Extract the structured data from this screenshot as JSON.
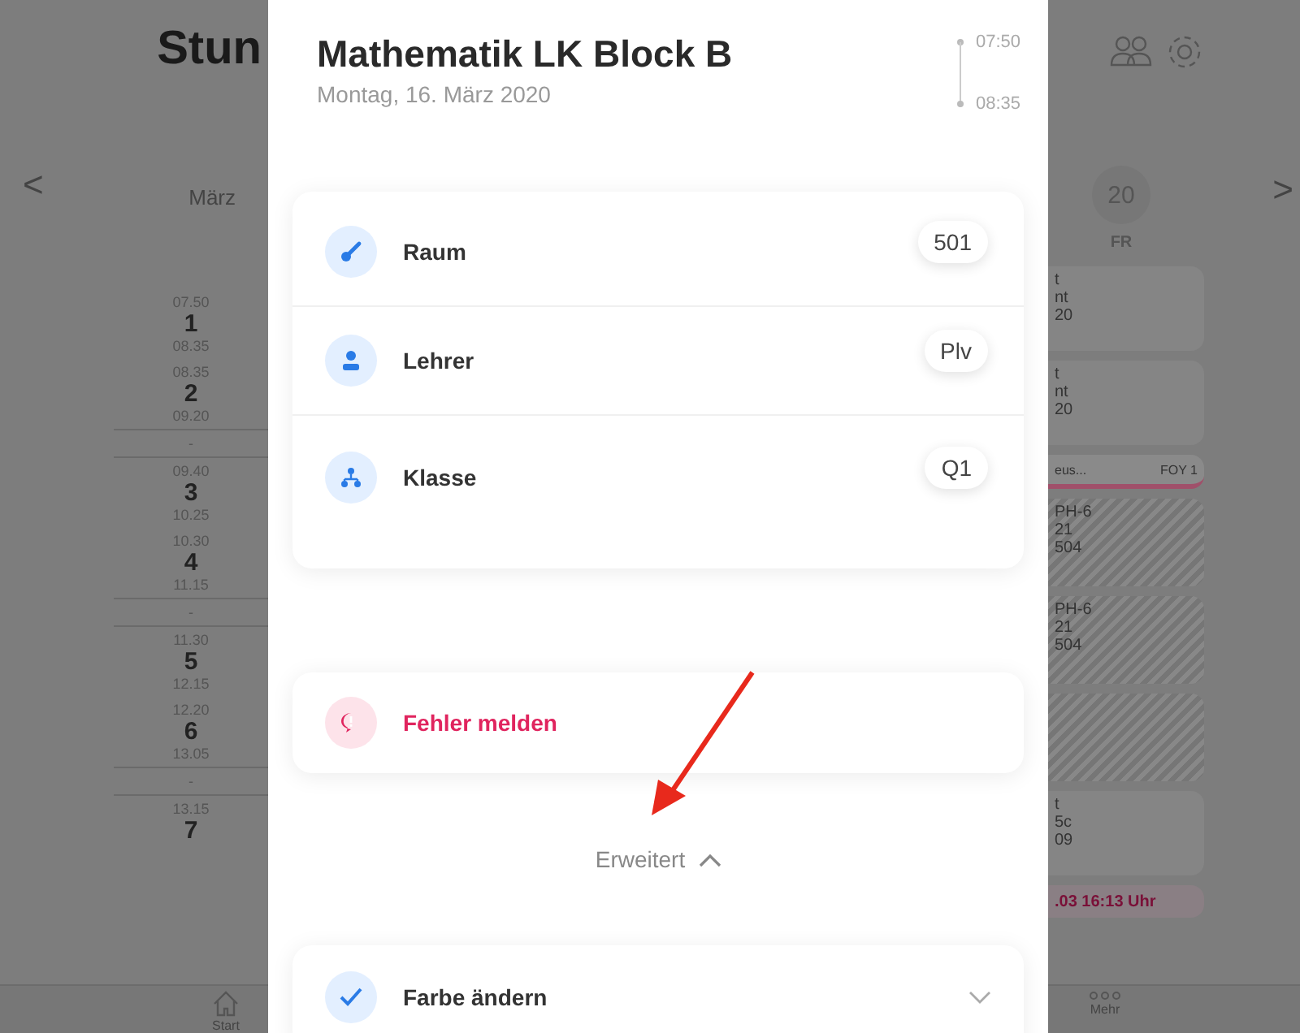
{
  "background": {
    "title": "Stun",
    "month": "März",
    "prev": "<",
    "next": ">",
    "day": {
      "number": "20",
      "weekday": "FR"
    },
    "periods": [
      {
        "kind": "lesson",
        "start": "07.50",
        "number": "1",
        "end": "08.35"
      },
      {
        "kind": "lesson",
        "start": "08.35",
        "number": "2",
        "end": "09.20"
      },
      {
        "kind": "break",
        "label": "-"
      },
      {
        "kind": "lesson",
        "start": "09.40",
        "number": "3",
        "end": "10.25"
      },
      {
        "kind": "lesson",
        "start": "10.30",
        "number": "4",
        "end": "11.15"
      },
      {
        "kind": "break",
        "label": "-"
      },
      {
        "kind": "lesson",
        "start": "11.30",
        "number": "5",
        "end": "12.15"
      },
      {
        "kind": "lesson",
        "start": "12.20",
        "number": "6",
        "end": "13.05"
      },
      {
        "kind": "break",
        "label": "-"
      },
      {
        "kind": "lesson",
        "start": "13.15",
        "number": "7"
      }
    ],
    "cards": [
      {
        "kind": "card",
        "lines": [
          "t",
          "nt",
          "20"
        ]
      },
      {
        "kind": "card",
        "lines": [
          "t",
          "nt",
          "20"
        ]
      },
      {
        "kind": "alert",
        "lines": [
          "eus...",
          "FOY 1"
        ]
      },
      {
        "kind": "hatched",
        "lines": [
          "PH-6",
          "21",
          "504"
        ]
      },
      {
        "kind": "hatched",
        "lines": [
          "PH-6",
          "21",
          "504"
        ]
      },
      {
        "kind": "hatched"
      },
      {
        "kind": "card",
        "lines": [
          "t",
          "5c",
          "09"
        ]
      },
      {
        "kind": "notice",
        "lines": [
          ".03 16:13 Uhr"
        ]
      }
    ],
    "nav": [
      {
        "kind": "home",
        "label": "Start"
      },
      {
        "kind": "more",
        "label": "Mehr"
      }
    ]
  },
  "sheet": {
    "title": "Mathematik LK Block B",
    "date": "Montag, 16. März 2020",
    "start": "07:50",
    "end": "08:35",
    "details": [
      {
        "kind": "room",
        "label": "Raum",
        "value": "501"
      },
      {
        "kind": "teacher",
        "label": "Lehrer",
        "value": "Plv"
      },
      {
        "kind": "class",
        "label": "Klasse",
        "value": "Q1"
      }
    ],
    "report": {
      "label": "Fehler melden"
    },
    "expand": {
      "label": "Erweitert",
      "expanded": true
    },
    "color_row": {
      "label": "Farbe ändern",
      "expanded": false
    }
  }
}
